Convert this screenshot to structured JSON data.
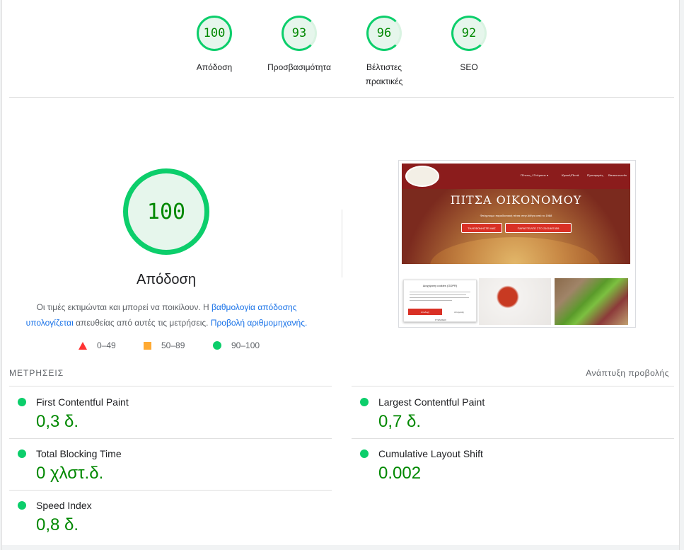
{
  "top_gauges": [
    {
      "score": "100",
      "label": "Απόδοση"
    },
    {
      "score": "93",
      "label": "Προσβασιμότητα"
    },
    {
      "score": "96",
      "label": "Βέλτιστες πρακτικές"
    },
    {
      "score": "92",
      "label": "SEO"
    }
  ],
  "main": {
    "score": "100",
    "title": "Απόδοση",
    "desc_part1": "Οι τιμές εκτιμώνται και μπορεί να ποικίλουν. Η ",
    "desc_link1": "βαθμολογία απόδοσης υπολογίζεται",
    "desc_part2": " απευθείας από αυτές τις μετρήσεις. ",
    "desc_link2": "Προβολή αριθμομηχανής.",
    "legend": [
      {
        "range": "0–49"
      },
      {
        "range": "50–89"
      },
      {
        "range": "90–100"
      }
    ]
  },
  "thumbnail": {
    "site_title": "ΠΙΤΣΑ ΟΙΚΟΝΟΜΟΥ",
    "subtitle": "Φτιάχνουμε παραδοσιακή πίτσα στην Αθήνα από το 1988",
    "nav_items": [
      "Πίτσες / Γεύματα ▾",
      "Κρασί/Ποτά",
      "Προσφορές",
      "Επικοινωνία"
    ],
    "btn1": "ΤΗΛΕΦΩΝΗΣΤΕ ΜΑΣ",
    "btn2": "ΠΑΡΑΓΓΕΙΛΤΕ ΣΤΟ 2101987459",
    "cookie_title": "Διαχείριση cookies (GDPR)",
    "cookie_accept": "Αποδοχή",
    "cookie_deny": "Απόρριψη",
    "cookie_prefs": "ΡΥΘΜΙΣΕΙΣ"
  },
  "metrics": {
    "heading": "ΜΕΤΡΗΣΕΙΣ",
    "expand_label": "Ανάπτυξη προβολής",
    "items": [
      {
        "name": "First Contentful Paint",
        "value": "0,3 δ."
      },
      {
        "name": "Largest Contentful Paint",
        "value": "0,7 δ."
      },
      {
        "name": "Total Blocking Time",
        "value": "0 χλστ.δ."
      },
      {
        "name": "Cumulative Layout Shift",
        "value": "0.002"
      },
      {
        "name": "Speed Index",
        "value": "0,8 δ."
      }
    ]
  },
  "colors": {
    "pass": "#0cce6b",
    "pass_text": "#008800",
    "average": "#ffaa33",
    "fail": "#ff3333",
    "link": "#1a73e8"
  },
  "icons": {
    "legend_fail": "triangle-icon",
    "legend_average": "square-icon",
    "legend_pass": "circle-icon"
  }
}
